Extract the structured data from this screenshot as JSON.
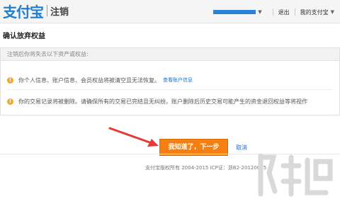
{
  "header": {
    "logo_text": "支付宝",
    "section_title": "注销",
    "links": [
      "退出",
      "我的支付宝"
    ]
  },
  "page": {
    "title": "确认放弃权益"
  },
  "notice": {
    "header_text": "注销后你将失去以下资产或权益:",
    "items": [
      {
        "text": "你个人信息、账户信息、会员权益将被清空且无法恢复。",
        "link": "查看账户信息"
      },
      {
        "text": "你的交易记录将被删除。请确保所有的交易已完结且无纠纷。账户删除后历史交易可能产生的资金退回权益等将视作"
      }
    ]
  },
  "actions": {
    "primary_label": "我知道了，下一步",
    "cancel_label": "取消"
  },
  "footer": {
    "copyright": "支付宝版权所有 2004-2015 ICP证：浙B2-20120045"
  },
  "colors": {
    "brand_blue": "#1e7fd1",
    "button_orange": "#f57f13",
    "arrow_red": "#e53935",
    "warning_orange": "#f5a623"
  }
}
